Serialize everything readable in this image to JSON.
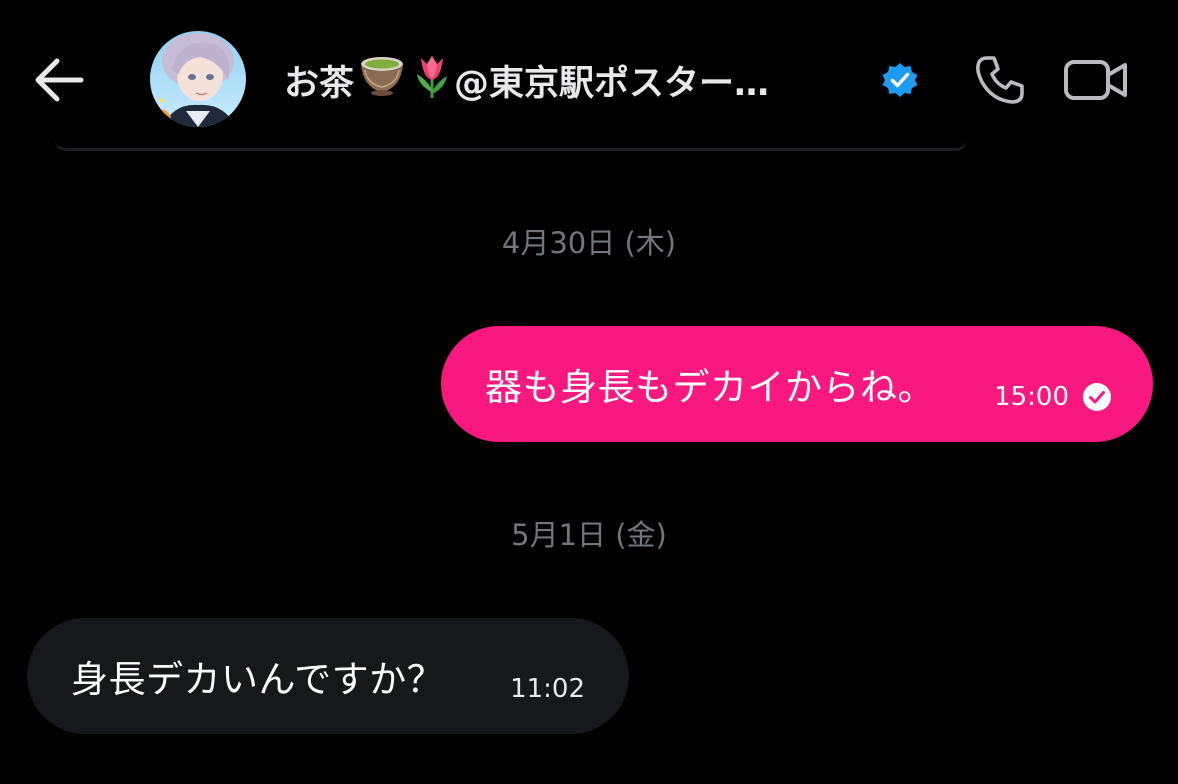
{
  "header": {
    "back_icon": "arrow-left-icon",
    "contact": {
      "name_prefix": "お茶",
      "emoji_1": "teacup-emoji",
      "emoji_2": "tulip-emoji",
      "name_suffix": "@東京駅ポスター…",
      "verified_icon": "verified-badge-icon",
      "verified_color": "#1d9bf0"
    },
    "call_icon": "phone-icon",
    "video_icon": "video-camera-icon"
  },
  "conversation": {
    "date_separators": [
      "4月30日 (木)",
      "5月1日 (金)"
    ],
    "messages": [
      {
        "direction": "sent",
        "text": "器も身長もデカイからね。",
        "time": "15:00",
        "status_icon": "read-check-icon"
      },
      {
        "direction": "received",
        "text": "身長デカいんですか？",
        "time": "11:02"
      }
    ]
  },
  "colors": {
    "background": "#000000",
    "sent_bubble": "#f91880",
    "received_bubble": "#16181c",
    "muted_text": "#71767b",
    "primary_text": "#e7e9ea"
  }
}
